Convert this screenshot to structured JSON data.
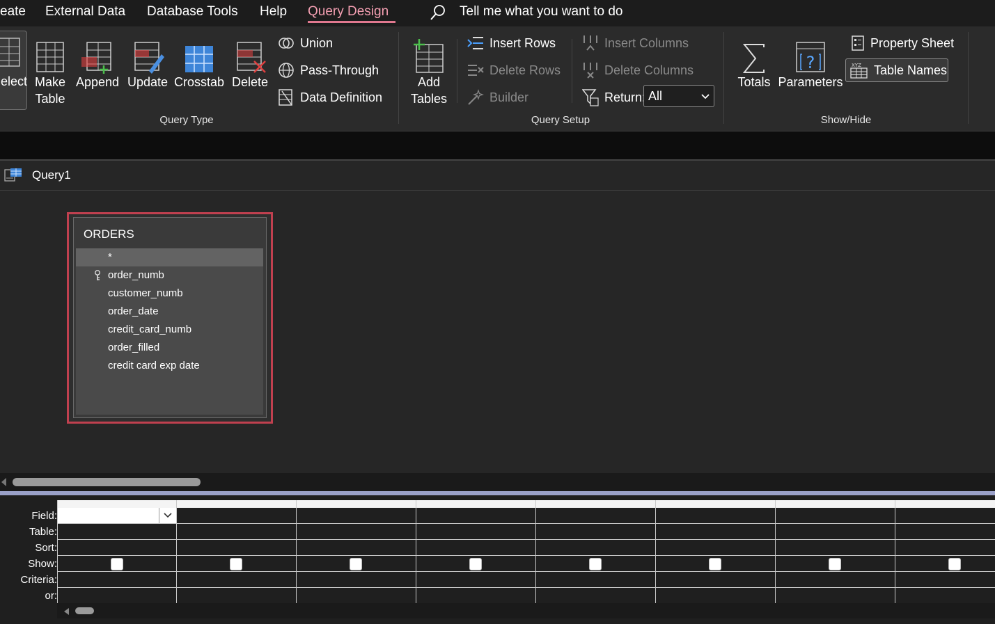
{
  "menu": {
    "items": [
      "eate",
      "External Data",
      "Database Tools",
      "Help",
      "Query Design"
    ],
    "active": "Query Design",
    "tell_me": "Tell me what you want to do"
  },
  "ribbon": {
    "query_type": {
      "label": "Query Type",
      "select": "elect",
      "make_table": [
        "Make",
        "Table"
      ],
      "append": "Append",
      "update": "Update",
      "crosstab": "Crosstab",
      "delete": "Delete",
      "union": "Union",
      "pass_through": "Pass-Through",
      "data_definition": "Data Definition"
    },
    "query_setup": {
      "label": "Query Setup",
      "add_tables": [
        "Add",
        "Tables"
      ],
      "insert_rows": "Insert Rows",
      "delete_rows": "Delete Rows",
      "builder": "Builder",
      "insert_columns": "Insert Columns",
      "delete_columns": "Delete Columns",
      "return_label": "Return:",
      "return_value": "All"
    },
    "show_hide": {
      "label": "Show/Hide",
      "totals": "Totals",
      "parameters": "Parameters",
      "property_sheet": "Property Sheet",
      "table_names": "Table Names",
      "xyz": "XYZ"
    }
  },
  "document": {
    "tab_title": "Query1"
  },
  "table": {
    "name": "ORDERS",
    "fields": [
      "*",
      "order_numb",
      "customer_numb",
      "order_date",
      "credit_card_numb",
      "order_filled",
      "credit card exp date"
    ],
    "primary_key": "order_numb"
  },
  "grid": {
    "row_labels": [
      "Field:",
      "Table:",
      "Sort:",
      "Show:",
      "Criteria:",
      "or:"
    ],
    "column_count": 8
  },
  "colors": {
    "accent": "#f49fb2",
    "selection_border": "#c0404f",
    "background": "#262626",
    "ribbon": "#2b2b2b"
  }
}
